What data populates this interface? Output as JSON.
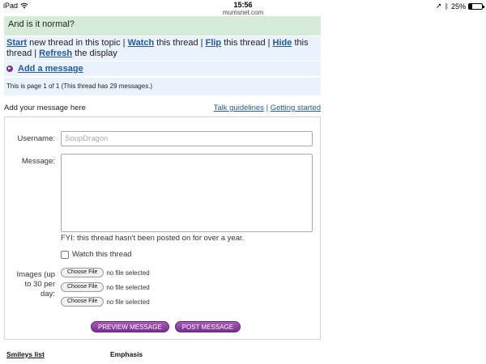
{
  "status_bar": {
    "device": "iPad",
    "time": "15:56",
    "domain": "mumsnet.com",
    "battery": "25%",
    "battery_level": 0.25
  },
  "thread": {
    "message_tail": "And is it normal?"
  },
  "actions": {
    "start": "Start",
    "start_rest": " new thread in this topic | ",
    "watch": "Watch",
    "watch_rest": " this thread | ",
    "flip": "Flip",
    "flip_rest": " this thread | ",
    "hide": "Hide",
    "hide_rest": " this thread | ",
    "refresh": "Refresh",
    "refresh_rest": " the display"
  },
  "add_message_link": "Add a message",
  "page_info": "This is page 1 of 1 (This thread has 29 messages.)",
  "add_header": {
    "title": "Add your message here",
    "talk_guidelines": "Talk guidelines",
    "separator": "|",
    "getting_started": "Getting started"
  },
  "form": {
    "username_label": "Username:",
    "username_value": "SoupDragon",
    "message_label": "Message:",
    "fyi": "FYI: this thread hasn't been posted on for over a year.",
    "watch_label": "Watch this thread",
    "images_label": "Images (up to 30 per day:",
    "files": [
      {
        "button": "Choose File",
        "status": "no file selected"
      },
      {
        "button": "Choose File",
        "status": "no file selected"
      },
      {
        "button": "Choose File",
        "status": "no file selected"
      }
    ],
    "preview_button": "PREVIEW MESSAGE",
    "post_button": "POST MESSAGE"
  },
  "footer": {
    "smileys": "Smileys list",
    "emphasis": "Emphasis"
  }
}
